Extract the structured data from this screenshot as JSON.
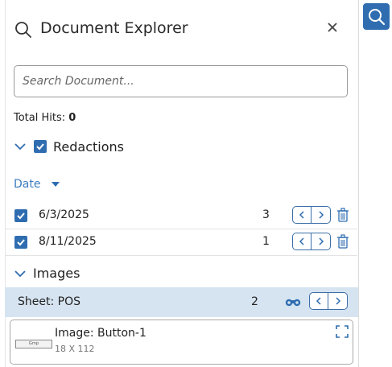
{
  "header": {
    "title": "Document Explorer"
  },
  "search": {
    "placeholder": "Search Document..."
  },
  "summary": {
    "total_label": "Total Hits:",
    "total_value": "0"
  },
  "redactions": {
    "label": "Redactions",
    "sort_label": "Date",
    "rows": [
      {
        "date": "6/3/2025",
        "count": "3"
      },
      {
        "date": "8/11/2025",
        "count": "1"
      }
    ]
  },
  "images": {
    "label": "Images",
    "sheet": {
      "label": "Sheet: POS",
      "count": "2"
    },
    "card": {
      "title": "Image: Button-1",
      "size": "18 X 112",
      "thumb_text": "Grnp"
    }
  },
  "colors": {
    "accent": "#2f6db0",
    "sheet_bg": "#d6e4f1"
  },
  "icons": [
    "search-icon",
    "close-icon",
    "chevron-down-icon",
    "check-icon",
    "caret-down-icon",
    "chevron-left-icon",
    "chevron-right-icon",
    "trash-icon",
    "binoculars-icon",
    "expand-icon"
  ]
}
